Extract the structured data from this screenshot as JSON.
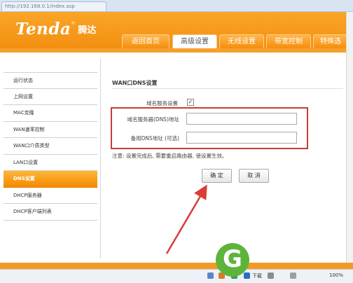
{
  "browser": {
    "tab_title": "http://192.168.0.1/index.asp"
  },
  "brand": {
    "logo_text": "Tenda",
    "logo_cn": "腾达",
    "colors": {
      "header": "#f5a02b",
      "accent": "#f28a00",
      "frame": "#c73b3b",
      "watermark": "#5cb53a"
    }
  },
  "nav": {
    "tabs": [
      {
        "label": "返回首页"
      },
      {
        "label": "高级设置"
      },
      {
        "label": "无线设置"
      },
      {
        "label": "带宽控制"
      },
      {
        "label": "特殊选"
      }
    ]
  },
  "sidebar": {
    "items": [
      {
        "label": "运行状态"
      },
      {
        "label": "上网设置"
      },
      {
        "label": "MAC克隆"
      },
      {
        "label": "WAN速率控制"
      },
      {
        "label": "WAN口介质类型"
      },
      {
        "label": "LAN口设置"
      },
      {
        "label": "DNS设置"
      },
      {
        "label": "DHCP服务器"
      },
      {
        "label": "DHCP客户端列表"
      }
    ]
  },
  "form": {
    "section_title": "WAN口DNS设置",
    "dns_service_label": "域名服务设置",
    "dns_service_checked": true,
    "checkmark": "✓",
    "primary_dns_label": "域名服务器(DNS)地址",
    "primary_dns_value": "",
    "secondary_dns_label": "备用DNS地址 (可选)",
    "secondary_dns_value": "",
    "note": "注意: 设置完成后, 需要重启路由器, 使设置生效。",
    "ok_label": "确 定",
    "cancel_label": "取 消"
  },
  "statusbar": {
    "download_label": "下载",
    "zoom_label": "100%"
  },
  "watermark": {
    "g": "G"
  }
}
